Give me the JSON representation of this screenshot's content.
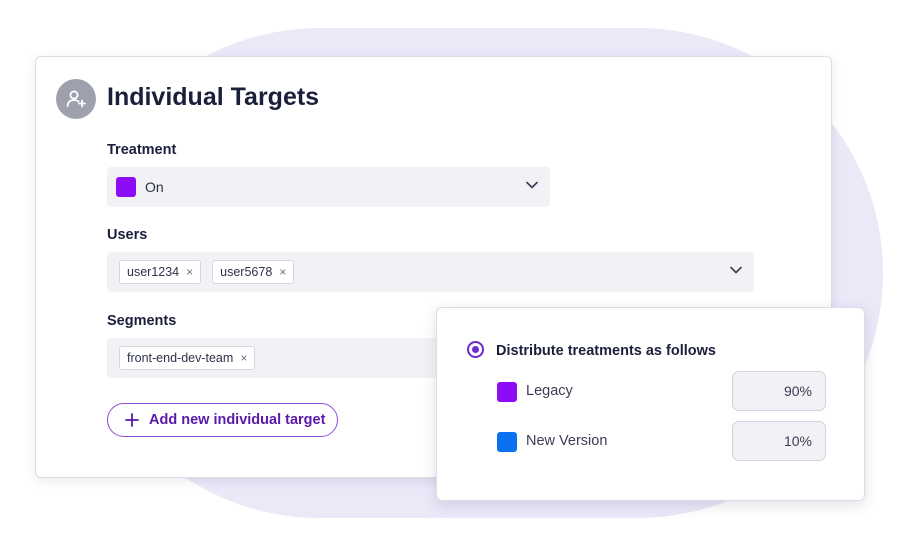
{
  "card": {
    "title": "Individual Targets",
    "avatar_icon": "user-plus-icon",
    "treatment": {
      "label": "Treatment",
      "value": "On",
      "color": "#8b0cf5"
    },
    "users": {
      "label": "Users",
      "tags": [
        "user1234",
        "user5678"
      ]
    },
    "segments": {
      "label": "Segments",
      "tags": [
        "front-end-dev-team"
      ]
    },
    "add_button": {
      "label": "Add new individual target",
      "icon": "plus-icon"
    },
    "remove_glyph": "×"
  },
  "distribution": {
    "title": "Distribute treatments as follows",
    "selected": true,
    "rows": [
      {
        "name": "Legacy",
        "color": "#8b0cf5",
        "percent": "90%"
      },
      {
        "name": "New Version",
        "color": "#0a72f0",
        "percent": "10%"
      }
    ]
  }
}
